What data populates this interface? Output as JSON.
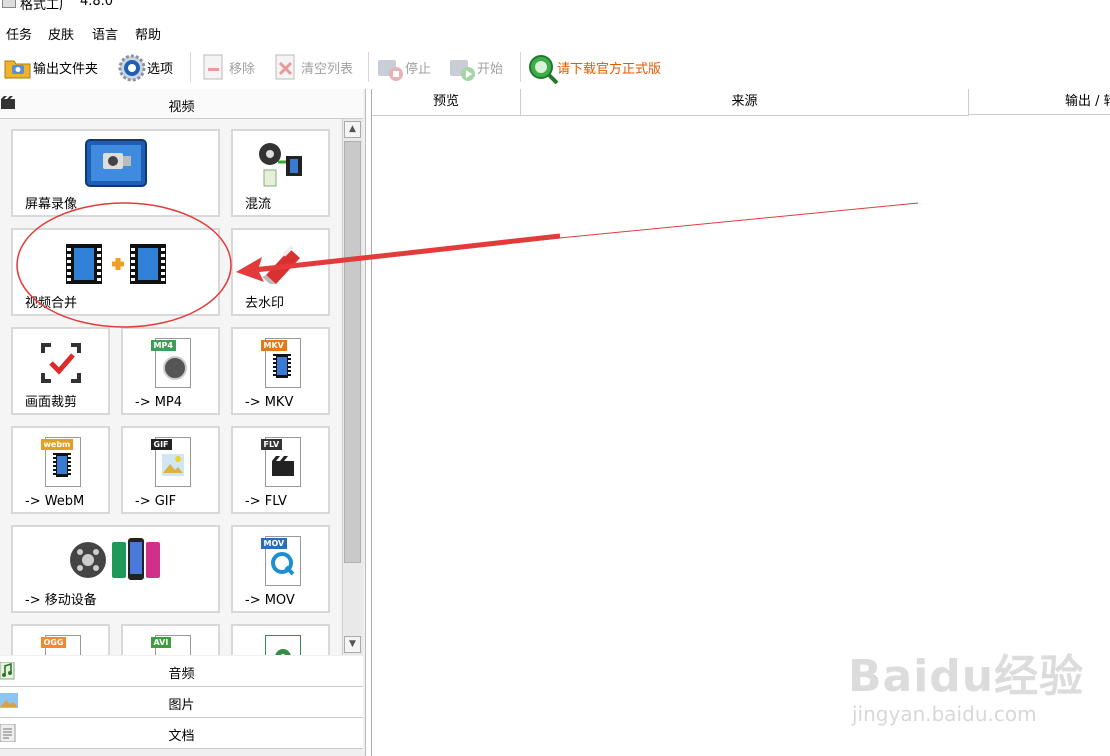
{
  "app": {
    "title": "格式工厂",
    "version": "4.8.0"
  },
  "menu": {
    "items": [
      "任务",
      "皮肤",
      "语言",
      "帮助"
    ]
  },
  "toolbar": {
    "output_folder": "输出文件夹",
    "options": "选项",
    "remove": "移除",
    "clear_list": "清空列表",
    "stop": "停止",
    "start": "开始",
    "download": "请下载官方正式版"
  },
  "categories": {
    "video": "视频",
    "audio": "音频",
    "image": "图片",
    "document": "文档"
  },
  "tiles": {
    "screen_record": "屏幕录像",
    "mux": "混流",
    "video_merge": "视频合并",
    "watermark_remove": "去水印",
    "crop": "画面裁剪",
    "to_mp4": "-> MP4",
    "to_mkv": "-> MKV",
    "to_webm": "-> WebM",
    "to_gif": "-> GIF",
    "to_flv": "-> FLV",
    "to_mobile": "-> 移动设备",
    "to_mov": "-> MOV"
  },
  "badges": {
    "mp4": "MP4",
    "mkv": "MKV",
    "webm": "webm",
    "gif": "GIF",
    "flv": "FLV",
    "mov": "MOV",
    "ogg": "OGG",
    "avi": "AVI"
  },
  "list": {
    "columns": [
      "预览",
      "来源",
      "输出 / 转"
    ]
  },
  "watermark": {
    "brand": "Baidu经验",
    "url": "jingyan.baidu.com"
  },
  "colors": {
    "annotation": "#e33b3b",
    "download_text": "#e05a00"
  }
}
